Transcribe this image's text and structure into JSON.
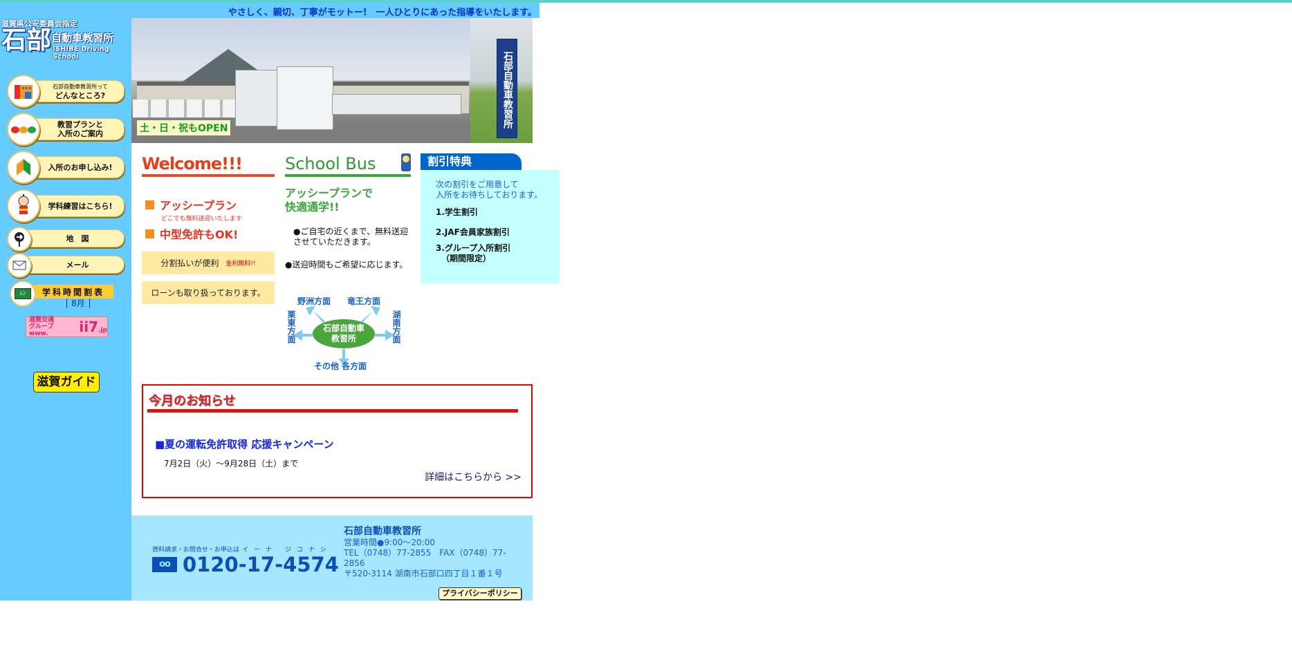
{
  "header": {
    "tagline": "やさしく、親切、丁寧がモットー!　一人ひとりにあった指導をいたします。"
  },
  "logo": {
    "designation": "滋賀県公安委員会指定",
    "name_large": "石部",
    "name_rest": "自動車教習所",
    "name_en": "ISHIBE Driving School"
  },
  "sidebar": {
    "items": [
      {
        "icon": "school-building-icon",
        "small": "石部自動車教習所って",
        "label": "どんなところ?"
      },
      {
        "icon": "cars-icon",
        "label_line1": "教習プランと",
        "label_line2": "入所のご案内"
      },
      {
        "icon": "beginner-mark-icon",
        "label": "入所のお申し込み!"
      },
      {
        "icon": "robot-mascot-icon",
        "label": "学科練習はこちら!"
      },
      {
        "icon": "map-pin-icon",
        "label": "地　図"
      },
      {
        "icon": "mail-icon",
        "label": "メール"
      }
    ],
    "schedule": {
      "icon": "blackboard-icon",
      "board_text": "ﾚﾝ",
      "label": "学科時間割表",
      "month": "8月"
    },
    "banner_ii7": {
      "line1": "滋賀交通",
      "line2": "グループ www.",
      "logo": "ii7",
      "tld": ".jp"
    },
    "banner_shiga": "滋賀ガイド"
  },
  "photo": {
    "open_badge": "土・日・祝もOPEN",
    "sign_small": "滋賀県公安委員会指定",
    "sign_text": "石部自動車教習所"
  },
  "welcome": {
    "title": "Welcome!!!",
    "plans": [
      {
        "heading": "アッシープラン",
        "sub": "どこでも無料送迎いたします"
      },
      {
        "heading": "中型免許もOK!",
        "sub": ""
      }
    ],
    "box1": {
      "text": "分割払いが便利",
      "note": "金利無料!!"
    },
    "box2": {
      "text": "ローンも取り扱っております。"
    }
  },
  "school_bus": {
    "title": "School Bus",
    "subtitle_line1": "アッシープランで",
    "subtitle_line2": "快適通学!!",
    "points": [
      "●ご自宅の近くまで、無料送迎させていただきます。",
      "●送迎時間もご希望に応じます。"
    ],
    "map": {
      "center_line1": "石部自動車",
      "center_line2": "教習所",
      "top_left": "野洲方面",
      "top_right": "竜王方面",
      "left": "栗東方面",
      "right": "湖南方面",
      "bottom": "その他 各方面"
    }
  },
  "discount": {
    "title": "割引特典",
    "intro_line1": "次の割引をご用意して",
    "intro_line2": "入所をお待ちしております。",
    "items": [
      "1.学生割引",
      "2.JAF会員家族割引",
      "3.グループ入所割引",
      "（期間限定）"
    ]
  },
  "notice": {
    "title": "今月のお知らせ",
    "campaign": "■夏の運転免許取得 応援キャンペーン",
    "period": "7月2日（火）～9月28日（土）まで",
    "more_link": "詳細はこちらから >>"
  },
  "footer": {
    "call_label": "資料請求・お問合せ・お申込は",
    "call_kana": "イーナ ジコナシ",
    "freedial_icon": "freedial-icon",
    "phone": "0120-17-4574",
    "school_name": "石部自動車教習所",
    "hours": "営業時間●9:00～20:00",
    "tel_fax": "TEL（0748）77-2855　FAX（0748）77-2856",
    "address": "〒520-3114 湖南市石部口四丁目１番１号",
    "privacy_button": "プライバシーポリシー"
  }
}
